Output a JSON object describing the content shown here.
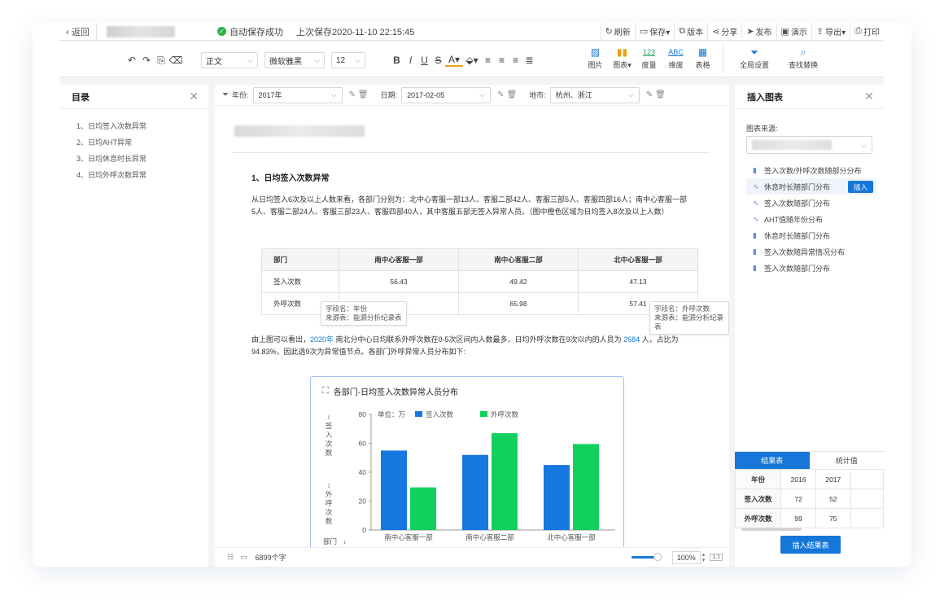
{
  "topbar": {
    "back_label": "返回",
    "save_status": "自动保存成功",
    "last_save": "上次保存2020-11-10 22:15:45",
    "actions": [
      {
        "icon": "refresh-icon",
        "glyph": "↻",
        "label": "刷新"
      },
      {
        "icon": "save-icon",
        "glyph": "▭",
        "label": "保存▾"
      },
      {
        "icon": "version-icon",
        "glyph": "⧉",
        "label": "版本"
      },
      {
        "icon": "share-icon",
        "glyph": "⋖",
        "label": "分享"
      },
      {
        "icon": "publish-icon",
        "glyph": "➤",
        "label": "发布"
      },
      {
        "icon": "present-icon",
        "glyph": "▣",
        "label": "演示"
      },
      {
        "icon": "export-icon",
        "glyph": "⇪",
        "label": "导出▾"
      },
      {
        "icon": "print-icon",
        "glyph": "⎙",
        "label": "打印"
      }
    ]
  },
  "toolbar": {
    "style_value": "正文",
    "font_value": "微软雅黑",
    "size_value": "12",
    "insert_items": [
      {
        "icon": "image-icon",
        "glyph": "▨",
        "label": "图片"
      },
      {
        "icon": "chart-icon",
        "glyph": "▮▮",
        "label": "图表▾"
      },
      {
        "icon": "measure-icon",
        "glyph": "123",
        "label": "度量"
      },
      {
        "icon": "dimension-icon",
        "glyph": "ABC",
        "label": "维度"
      },
      {
        "icon": "table-icon",
        "glyph": "▦",
        "label": "表格"
      }
    ],
    "global_settings": "全局设置",
    "find_replace": "查找替换"
  },
  "toc": {
    "title": "目录",
    "items": [
      "1、日均签入次数异常",
      "2、日均AHT异常",
      "3、日均休息时长异常",
      "4、日均外呼次数异常"
    ]
  },
  "filters": {
    "year_label": "年份:",
    "year_value": "2017年",
    "date_label": "日期:",
    "date_value": "2017-02-05",
    "city_label": "地市:",
    "city_value": "杭州、浙江"
  },
  "doc": {
    "heading": "1、日均签入次数异常",
    "para1": "从日均签入6次及以上人数来看，各部门分别为：北中心客服一部13人、客服二部42人、客服三部5人、客服四部16人；南中心客服一部5人、客服二部24人、客服三部23人、客服四部40人，其中客服五部无签入异常人员。（图中橙色区域为日均签入8次及以上人数）",
    "table": {
      "headers": [
        "部门",
        "南中心客服一部",
        "南中心客服二部",
        "北中心客服一部"
      ],
      "rows": [
        [
          "签入次数",
          "56.43",
          "49.42",
          "47.13"
        ],
        [
          "外呼次数",
          "",
          "65.98",
          "57.41"
        ]
      ]
    },
    "tip1": {
      "line1": "字段名：年份",
      "line2": "来源表：能源分析纪录表"
    },
    "tip2": {
      "line1": "字段名：外呼次数",
      "line2": "来源表：能源分析纪录表"
    },
    "para2_a": "由上图可以看出，",
    "para2_year": "2020年",
    "para2_b": " 南北分中心日均联系外呼次数在0-5次区间内人数最多，日均外呼次数在9次以内的人员为 ",
    "para2_count": "2684",
    "para2_c": " 人，占比为94.83%，因此选9次为异常值节点。各部门外呼异常人员分布如下:",
    "word_count": "6899个字",
    "zoom": "100%"
  },
  "chart_data": {
    "type": "bar",
    "title": "各部门-日均签入次数异常人员分布",
    "unit_label": "单位：万",
    "y_axis_label_1": "签入次数",
    "y_axis_label_2": "外呼次数",
    "x_axis_label": "部门",
    "categories": [
      "南中心客服一部",
      "南中心客服二部",
      "北中心客服一部"
    ],
    "series": [
      {
        "name": "签入次数",
        "color": "#1677e0",
        "values": [
          55,
          52,
          45
        ]
      },
      {
        "name": "外呼次数",
        "color": "#12d05e",
        "values": [
          29.5,
          67,
          59.5
        ]
      }
    ],
    "yticks": [
      "80",
      "60",
      "40",
      "20",
      "0"
    ],
    "ylim": [
      0,
      80
    ],
    "grid": false,
    "legend": "top-left"
  },
  "right_panel": {
    "title": "插入图表",
    "source_label": "图表来源:",
    "charts": [
      {
        "icon": "bar-chart-icon",
        "glyph": "▮",
        "label": "签入次数/外呼次数随部分分布"
      },
      {
        "icon": "line-chart-icon",
        "glyph": "∿",
        "label": "休息时长随部门分布",
        "active": true
      },
      {
        "icon": "line-chart-icon",
        "glyph": "∿",
        "label": "签入次数随部门分布"
      },
      {
        "icon": "line-chart-icon",
        "glyph": "∿",
        "label": "AHT值随年份分布"
      },
      {
        "icon": "bar-chart-icon",
        "glyph": "▮",
        "label": "休息时长随部门分布"
      },
      {
        "icon": "bar-chart-icon",
        "glyph": "▮",
        "label": "签入次数随异常情况分布"
      },
      {
        "icon": "bar-chart-icon",
        "glyph": "▮",
        "label": "签入次数随部门分布"
      }
    ],
    "insert_label": "插入",
    "tabs": [
      "结果表",
      "统计值"
    ],
    "result_table": [
      [
        "年份",
        "2016",
        "2017",
        ""
      ],
      [
        "签入次数",
        "72",
        "52",
        ""
      ],
      [
        "外呼次数",
        "99",
        "75",
        ""
      ]
    ],
    "insert_result": "插入结果表"
  }
}
